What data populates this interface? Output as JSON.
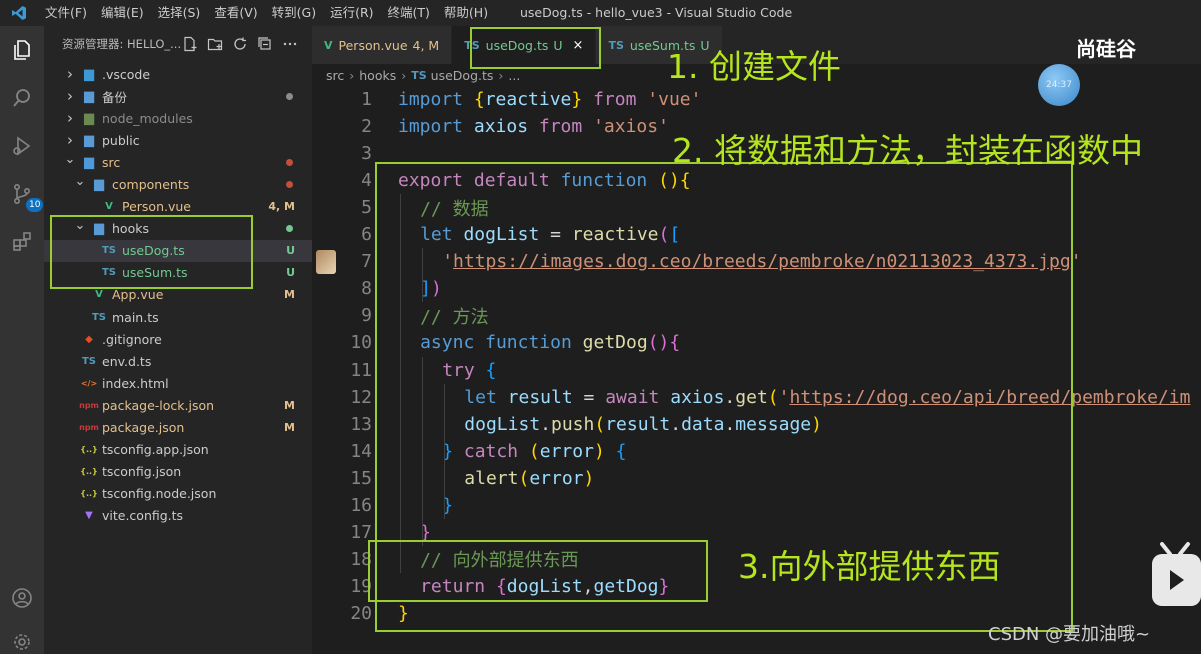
{
  "app": {
    "window_title": "useDog.ts - hello_vue3 - Visual Studio Code",
    "menu": [
      "文件(F)",
      "编辑(E)",
      "选择(S)",
      "查看(V)",
      "转到(G)",
      "运行(R)",
      "终端(T)",
      "帮助(H)"
    ]
  },
  "activity_bar": {
    "icons": [
      "explorer-icon",
      "search-icon",
      "run-debug-icon",
      "source-control-icon",
      "extensions-icon",
      "account-icon",
      "settings-gear-icon"
    ],
    "source_control_badge": "10"
  },
  "sidebar": {
    "title": "资源管理器: HELLO_...",
    "tree": [
      {
        "name": ".vscode",
        "type": "folder",
        "depth": 0,
        "open": false,
        "icon": "vscode-folder-icon",
        "color": "default"
      },
      {
        "name": "备份",
        "type": "folder",
        "depth": 0,
        "open": false,
        "icon": "folder-icon",
        "color": "default",
        "dot": "#8c8c8c"
      },
      {
        "name": "node_modules",
        "type": "folder",
        "depth": 0,
        "open": false,
        "icon": "node-folder-icon",
        "color": "ignored"
      },
      {
        "name": "public",
        "type": "folder",
        "depth": 0,
        "open": false,
        "icon": "folder-icon",
        "color": "default"
      },
      {
        "name": "src",
        "type": "folder",
        "depth": 0,
        "open": true,
        "icon": "src-folder-icon",
        "color": "mod",
        "dot": "#c74e39"
      },
      {
        "name": "components",
        "type": "folder",
        "depth": 1,
        "open": true,
        "icon": "folder-icon",
        "color": "mod",
        "dot": "#c74e39"
      },
      {
        "name": "Person.vue",
        "type": "file",
        "depth": 2,
        "icon": "vue-file-icon",
        "color": "mod",
        "status": "4, M",
        "status_kind": "m"
      },
      {
        "name": "hooks",
        "type": "folder",
        "depth": 1,
        "open": true,
        "icon": "folder-icon",
        "color": "default",
        "dot": "#73c991"
      },
      {
        "name": "useDog.ts",
        "type": "file",
        "depth": 2,
        "icon": "ts-file-icon",
        "color": "untracked",
        "status": "U",
        "status_kind": "u",
        "selected": true
      },
      {
        "name": "useSum.ts",
        "type": "file",
        "depth": 2,
        "icon": "ts-file-icon",
        "color": "untracked",
        "status": "U",
        "status_kind": "u"
      },
      {
        "name": "App.vue",
        "type": "file",
        "depth": 1,
        "icon": "vue-file-icon",
        "color": "mod",
        "status": "M",
        "status_kind": "m"
      },
      {
        "name": "main.ts",
        "type": "file",
        "depth": 1,
        "icon": "ts-file-icon",
        "color": "default"
      },
      {
        "name": ".gitignore",
        "type": "file",
        "depth": 0,
        "icon": "git-file-icon",
        "color": "default"
      },
      {
        "name": "env.d.ts",
        "type": "file",
        "depth": 0,
        "icon": "ts-file-icon",
        "color": "default"
      },
      {
        "name": "index.html",
        "type": "file",
        "depth": 0,
        "icon": "html-file-icon",
        "color": "default"
      },
      {
        "name": "package-lock.json",
        "type": "file",
        "depth": 0,
        "icon": "npm-file-icon",
        "color": "mod",
        "status": "M",
        "status_kind": "m"
      },
      {
        "name": "package.json",
        "type": "file",
        "depth": 0,
        "icon": "npm-file-icon",
        "color": "mod",
        "status": "M",
        "status_kind": "m"
      },
      {
        "name": "tsconfig.app.json",
        "type": "file",
        "depth": 0,
        "icon": "json-file-icon",
        "color": "default"
      },
      {
        "name": "tsconfig.json",
        "type": "file",
        "depth": 0,
        "icon": "json-file-icon",
        "color": "default"
      },
      {
        "name": "tsconfig.node.json",
        "type": "file",
        "depth": 0,
        "icon": "json-file-icon",
        "color": "default"
      },
      {
        "name": "vite.config.ts",
        "type": "file",
        "depth": 0,
        "icon": "vite-file-icon",
        "color": "default"
      }
    ]
  },
  "tabs": [
    {
      "label": "Person.vue",
      "status": "4, M",
      "icon": "vue-file-icon",
      "icon_text": "V",
      "active": false,
      "color": "#e2c08d"
    },
    {
      "label": "useDog.ts",
      "status": "U",
      "icon": "ts-file-icon",
      "icon_text": "TS",
      "active": true,
      "color": "#73c991",
      "close": "×"
    },
    {
      "label": "useSum.ts",
      "status": "U",
      "icon": "ts-file-icon",
      "icon_text": "TS",
      "active": false,
      "color": "#73c991"
    }
  ],
  "breadcrumb": {
    "parts": [
      "src",
      "hooks"
    ],
    "file_icon": "TS",
    "file": "useDog.ts",
    "tail": "..."
  },
  "editor": {
    "lines": [
      {
        "n": "1",
        "indent": 0,
        "tokens": [
          [
            "kw",
            "import "
          ],
          [
            "p1",
            "{"
          ],
          [
            "var",
            "reactive"
          ],
          [
            "p1",
            "}"
          ],
          [
            "ctl",
            " from "
          ],
          [
            "str",
            "'vue'"
          ]
        ]
      },
      {
        "n": "2",
        "indent": 0,
        "tokens": [
          [
            "kw",
            "import "
          ],
          [
            "var",
            "axios"
          ],
          [
            "ctl",
            " from "
          ],
          [
            "str",
            "'axios'"
          ]
        ]
      },
      {
        "n": "3",
        "indent": 0,
        "tokens": []
      },
      {
        "n": "4",
        "indent": 0,
        "tokens": [
          [
            "ctl",
            "export "
          ],
          [
            "ctl",
            "default "
          ],
          [
            "kw",
            "function "
          ],
          [
            "p1",
            "()"
          ],
          [
            "p1",
            "{"
          ]
        ]
      },
      {
        "n": "5",
        "indent": 1,
        "tokens": [
          [
            "cm",
            "// 数据"
          ]
        ]
      },
      {
        "n": "6",
        "indent": 1,
        "tokens": [
          [
            "kw",
            "let "
          ],
          [
            "var",
            "dogList"
          ],
          [
            "plain",
            " = "
          ],
          [
            "fn",
            "reactive"
          ],
          [
            "p2",
            "("
          ],
          [
            "p3",
            "["
          ]
        ]
      },
      {
        "n": "7",
        "indent": 2,
        "tokens": [
          [
            "str",
            "'"
          ],
          [
            "url",
            "https://images.dog.ceo/breeds/pembroke/n02113023_4373.jpg"
          ],
          [
            "str",
            "'"
          ]
        ]
      },
      {
        "n": "8",
        "indent": 1,
        "tokens": [
          [
            "p3",
            "]"
          ],
          [
            "p2",
            ")"
          ]
        ]
      },
      {
        "n": "9",
        "indent": 1,
        "tokens": [
          [
            "cm",
            "// 方法"
          ]
        ]
      },
      {
        "n": "10",
        "indent": 1,
        "tokens": [
          [
            "kw",
            "async "
          ],
          [
            "kw",
            "function "
          ],
          [
            "fn",
            "getDog"
          ],
          [
            "p2",
            "()"
          ],
          [
            "p2",
            "{"
          ]
        ]
      },
      {
        "n": "11",
        "indent": 2,
        "tokens": [
          [
            "ctl",
            "try "
          ],
          [
            "p3",
            "{"
          ]
        ]
      },
      {
        "n": "12",
        "indent": 3,
        "tokens": [
          [
            "kw",
            "let "
          ],
          [
            "var",
            "result"
          ],
          [
            "plain",
            " = "
          ],
          [
            "ctl",
            "await "
          ],
          [
            "var",
            "axios"
          ],
          [
            "plain",
            "."
          ],
          [
            "fn",
            "get"
          ],
          [
            "p1",
            "("
          ],
          [
            "str",
            "'"
          ],
          [
            "url",
            "https://dog.ceo/api/breed/pembroke/im"
          ]
        ]
      },
      {
        "n": "13",
        "indent": 3,
        "tokens": [
          [
            "var",
            "dogList"
          ],
          [
            "plain",
            "."
          ],
          [
            "fn",
            "push"
          ],
          [
            "p1",
            "("
          ],
          [
            "var",
            "result"
          ],
          [
            "plain",
            "."
          ],
          [
            "var",
            "data"
          ],
          [
            "plain",
            "."
          ],
          [
            "var",
            "message"
          ],
          [
            "p1",
            ")"
          ]
        ]
      },
      {
        "n": "14",
        "indent": 2,
        "tokens": [
          [
            "p3",
            "} "
          ],
          [
            "ctl",
            "catch "
          ],
          [
            "p1",
            "("
          ],
          [
            "var",
            "error"
          ],
          [
            "p1",
            ")"
          ],
          [
            "p3",
            " {"
          ]
        ]
      },
      {
        "n": "15",
        "indent": 3,
        "tokens": [
          [
            "fn",
            "alert"
          ],
          [
            "p1",
            "("
          ],
          [
            "var",
            "error"
          ],
          [
            "p1",
            ")"
          ]
        ]
      },
      {
        "n": "16",
        "indent": 2,
        "tokens": [
          [
            "p3",
            "}"
          ]
        ]
      },
      {
        "n": "17",
        "indent": 1,
        "tokens": [
          [
            "p2",
            "}"
          ]
        ]
      },
      {
        "n": "18",
        "indent": 1,
        "tokens": [
          [
            "cm",
            "// 向外部提供东西"
          ]
        ]
      },
      {
        "n": "19",
        "indent": 1,
        "tokens": [
          [
            "ctl",
            "return "
          ],
          [
            "p2",
            "{"
          ],
          [
            "var",
            "dogList"
          ],
          [
            "plain",
            ","
          ],
          [
            "var",
            "getDog"
          ],
          [
            "p2",
            "}"
          ]
        ]
      },
      {
        "n": "20",
        "indent": 0,
        "tokens": [
          [
            "p1",
            "}"
          ]
        ]
      }
    ]
  },
  "annotations": {
    "step1": "1. 创建文件",
    "step2": "2. 将数据和方法，封装在函数中",
    "step3": "3.向外部提供东西",
    "color": "#9acd32"
  },
  "overlays": {
    "brand": "尚硅谷",
    "timer": "24:37",
    "watermark": "CSDN @要加油哦~"
  }
}
